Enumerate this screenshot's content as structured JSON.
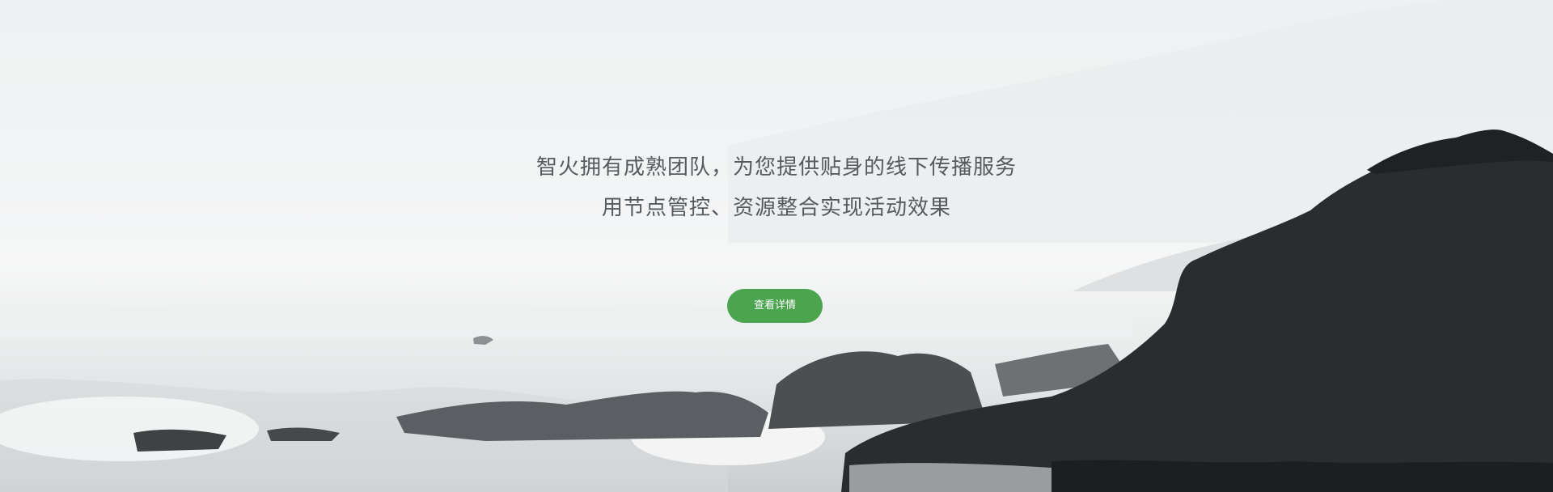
{
  "hero": {
    "tagline_line1": "智火拥有成熟团队，为您提供贴身的线下传播服务",
    "tagline_line2": "用节点管控、资源整合实现活动效果",
    "cta_label": "查看详情",
    "cta_color": "#4ba54f",
    "background_image": "misty-coastline-photo"
  }
}
